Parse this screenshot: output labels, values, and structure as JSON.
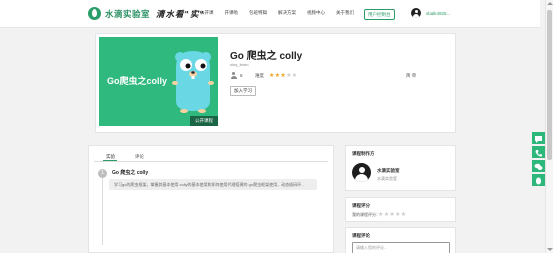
{
  "header": {
    "logo_text": "水滴实验室",
    "slogan": "清水看\"实\"",
    "nav": [
      "公开课",
      "开课啦",
      "包班特辑",
      "解决方案",
      "视频中心",
      "关于我们"
    ],
    "client_button": "用户控制台",
    "username": "sbalk4925..."
  },
  "course": {
    "title": "Go 爬虫之 colly",
    "author": "sinq_learn",
    "cover_text": "Go爬虫之colly",
    "cover_tag": "公开课程",
    "learners": "8",
    "difficulty_label": "难度",
    "difficulty_level": 3,
    "difficulty_max": 5,
    "level_text": "简 单",
    "join_button": "加入学习"
  },
  "tabs": [
    "实验",
    "评论"
  ],
  "labs": [
    {
      "number": "1",
      "title": "Go 爬虫之 colly",
      "description": "学习go的爬虫框架，掌握其基本使用 colly的基本使用和如何使用代理搭建的 go爬虫框架使用，动态插码环..."
    }
  ],
  "sidebar": {
    "author_section_title": "课程制作方",
    "author_name": "水滴实验室",
    "author_org": "水滴实验室",
    "rating_section_title": "课程评分",
    "rating_label": "我的课程评分：",
    "comment_section_title": "课程评论",
    "comment_placeholder": "请输入您的评论..."
  },
  "colors": {
    "brand": "#2a9d68",
    "cover": "#2fb97f",
    "float_buttons": "#2db77b",
    "star_on": "#f0a020"
  },
  "icons": [
    "logo-drop-icon",
    "user-icon",
    "people-icon",
    "star-icon",
    "phone-icon",
    "chat-icon",
    "qq-icon",
    "gopher-mascot"
  ]
}
